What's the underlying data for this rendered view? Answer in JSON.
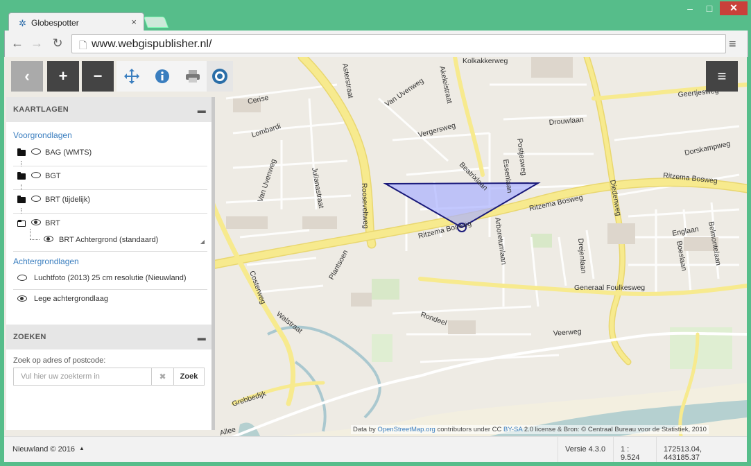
{
  "browser": {
    "tab_title": "Globespotter",
    "url": "www.webgispublisher.nl/"
  },
  "map_toolbar": {
    "back": "‹",
    "zoom_in": "+",
    "zoom_out": "−",
    "menu": "≡"
  },
  "panel": {
    "layers_title": "KAARTLAGEN",
    "foreground_label": "Voorgrondlagen",
    "layers": [
      {
        "name": "BAG (WMTS)",
        "visible": false
      },
      {
        "name": "BGT",
        "visible": false
      },
      {
        "name": "BRT (tijdelijk)",
        "visible": false
      },
      {
        "name": "BRT",
        "visible": true
      }
    ],
    "sublayer": "BRT Achtergrond (standaard)",
    "background_label": "Achtergrondlagen",
    "bg_layers": [
      {
        "name": "Luchtfoto (2013) 25 cm resolutie (Nieuwland)",
        "visible": false
      },
      {
        "name": "Lege achtergrondlaag",
        "visible": true
      }
    ],
    "search_title": "ZOEKEN",
    "search_label": "Zoek op adres of postcode:",
    "search_placeholder": "Vul hier uw zoekterm in",
    "search_clear": "✖",
    "search_button": "Zoek"
  },
  "map_labels": {
    "asterstraat": "Asterstraat",
    "akeleistraat": "Akeleistraat",
    "kolkakkerweg": "Kolkakkerweg",
    "cerise": "Cerise",
    "van_uvenweg_1": "Van Uvenweg",
    "van_uvenweg_2": "Van Uvenweg",
    "lombardi": "Lombardi",
    "vergersweg": "Vergersweg",
    "drouwlaan": "Drouwlaan",
    "geertjesweg": "Geertjesweg",
    "postjesweg": "Postjesweg",
    "essenlaan": "Essenlaan",
    "beatrixlaan": "Beatrixlaan",
    "dorskampweg": "Dorskampweg",
    "julianastraat": "Julianastraat",
    "rooseveltweg": "Rooseveltweg",
    "ritzema_bosweg_1": "Ritzema Bosweg",
    "ritzema_bosweg_2": "Ritzema Bosweg",
    "ritzema_bosweg_3": "Ritzema Bosweg",
    "diedenweg": "Diedenweg",
    "englaan": "Englaan",
    "belmontelaan": "Belmontelaan",
    "boeslaan": "Boeslaan",
    "drejenlaan": "Drejenlaan",
    "arboretumlaan": "Arboretumlaan",
    "plantsoen": "Plantsoen",
    "costerweg": "Costerweg",
    "walstraat": "Walstraat",
    "generaal_foulkesweg": "Generaal Foulkesweg",
    "rondeel": "Rondeel",
    "veerweg": "Veerweg",
    "grebbedijk": "Grebbedijk",
    "allee": "Allee"
  },
  "attribution": {
    "prefix": "Data by",
    "osm": "OpenStreetMap.org",
    "middle": "contributors under CC",
    "bysa": "BY-SA",
    "suffix": "2.0 license & Bron: © Centraal Bureau voor de Statistiek, 2010"
  },
  "status": {
    "credit": "Nieuwland © 2016",
    "version": "Versie 4.3.0",
    "scale": "1 : 9.524",
    "coords": "172513.04, 443185.37"
  },
  "colors": {
    "accent": "#3a7ebf",
    "dark_button": "#444444",
    "polygon_fill": "#aab0ff",
    "polygon_stroke": "#1a1a7a"
  }
}
